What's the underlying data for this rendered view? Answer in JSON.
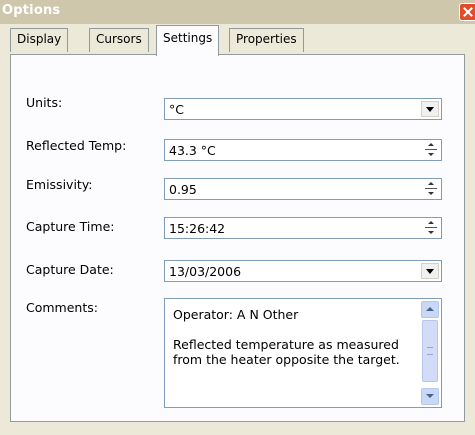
{
  "window": {
    "title": "Options"
  },
  "tabs": [
    {
      "label": "Display",
      "active": false
    },
    {
      "label": "Cursors",
      "active": false
    },
    {
      "label": "Settings",
      "active": true
    },
    {
      "label": "Properties",
      "active": false
    }
  ],
  "settings": {
    "units": {
      "label": "Units:",
      "value": "°C"
    },
    "reflected_temp": {
      "label": "Reflected Temp:",
      "value": "43.3 °C"
    },
    "emissivity": {
      "label": "Emissivity:",
      "value": "0.95"
    },
    "capture_time": {
      "label": "Capture Time:",
      "value": "15:26:42"
    },
    "capture_date": {
      "label": "Capture Date:",
      "value": "13/03/2006"
    },
    "comments": {
      "label": "Comments:",
      "value": "Operator: A N Other\n\nReflected temperature as measured from the heater opposite the target."
    }
  },
  "colors": {
    "title_bar": "#cfc7ab",
    "close_button": "#e44b29",
    "field_border": "#7f9db9",
    "panel": "#fcfcfe"
  }
}
